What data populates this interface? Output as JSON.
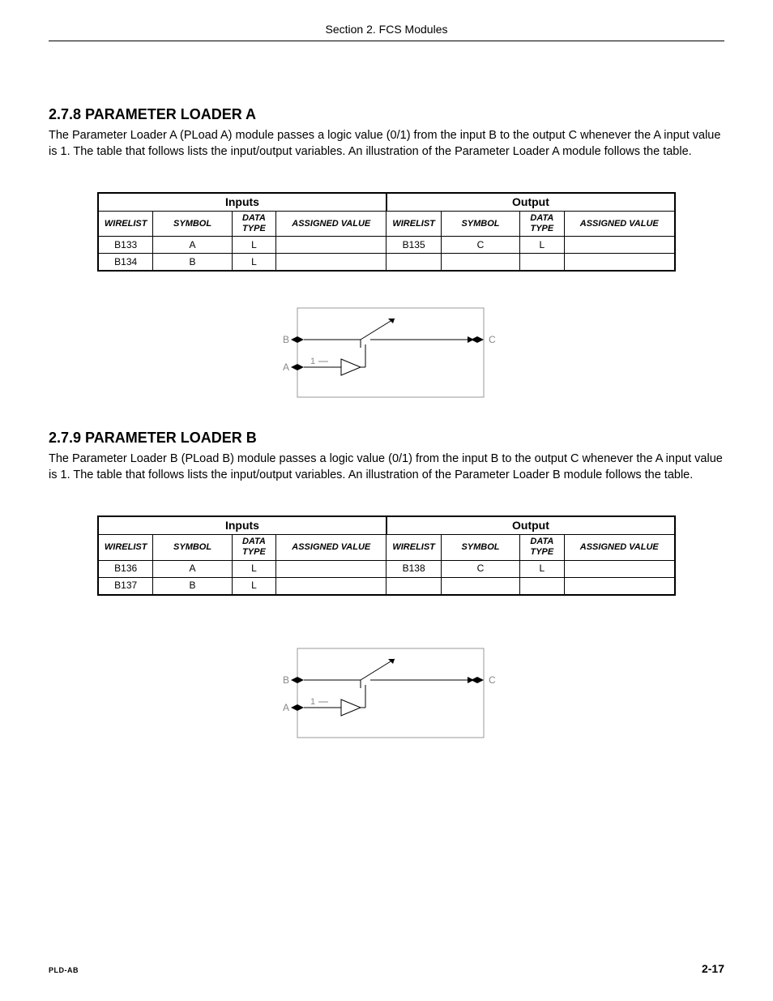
{
  "header": {
    "title": "Section 2. FCS Modules"
  },
  "sections": [
    {
      "heading": "2.7.8  PARAMETER LOADER A",
      "body": "The Parameter Loader A (PLoad A) module passes a logic value (0/1) from the input B to the output C whenever the A input value is 1.  The table that follows lists the input/output variables.  An illustration of the Parameter Loader A module follows the table.",
      "table": {
        "groups": {
          "inputs": "Inputs",
          "output": "Output"
        },
        "columns": {
          "wirelist": "WIRELIST",
          "symbol": "SYMBOL",
          "datatype": "DATA TYPE",
          "assigned": "ASSIGNED VALUE"
        },
        "rows": [
          {
            "in_wl": "B133",
            "in_sym": "A",
            "in_dt": "L",
            "in_av": "",
            "out_wl": "B135",
            "out_sym": "C",
            "out_dt": "L",
            "out_av": ""
          },
          {
            "in_wl": "B134",
            "in_sym": "B",
            "in_dt": "L",
            "in_av": "",
            "out_wl": "",
            "out_sym": "",
            "out_dt": "",
            "out_av": ""
          }
        ]
      },
      "diagram": {
        "B": "B",
        "A": "A",
        "C": "C",
        "one": "1"
      }
    },
    {
      "heading": "2.7.9  PARAMETER LOADER B",
      "body": "The Parameter Loader B (PLoad B) module passes a logic value (0/1) from the input B to the output C whenever the A input value is 1.  The table that follows lists the input/output variables.  An illustration of the Parameter Loader B module follows the table.",
      "table": {
        "groups": {
          "inputs": "Inputs",
          "output": "Output"
        },
        "columns": {
          "wirelist": "WIRELIST",
          "symbol": "SYMBOL",
          "datatype": "DATA TYPE",
          "assigned": "ASSIGNED VALUE"
        },
        "rows": [
          {
            "in_wl": "B136",
            "in_sym": "A",
            "in_dt": "L",
            "in_av": "",
            "out_wl": "B138",
            "out_sym": "C",
            "out_dt": "L",
            "out_av": ""
          },
          {
            "in_wl": "B137",
            "in_sym": "B",
            "in_dt": "L",
            "in_av": "",
            "out_wl": "",
            "out_sym": "",
            "out_dt": "",
            "out_av": ""
          }
        ]
      },
      "diagram": {
        "B": "B",
        "A": "A",
        "C": "C",
        "one": "1"
      }
    }
  ],
  "footer": {
    "left": "PLD-AB",
    "right": "2-17"
  }
}
